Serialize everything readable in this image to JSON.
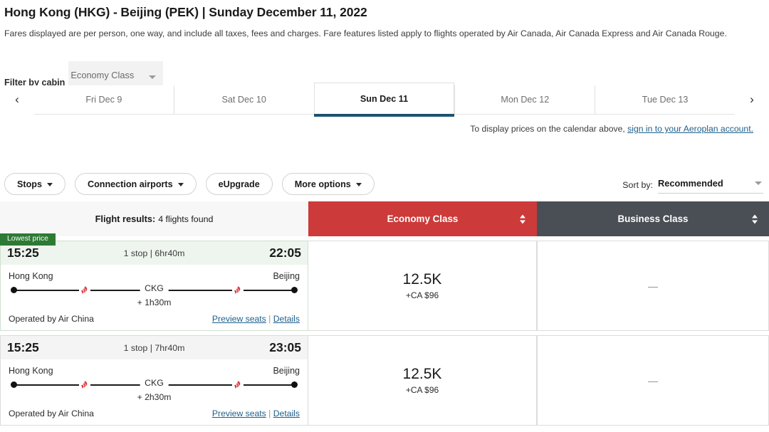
{
  "header": {
    "title": "Hong Kong (HKG) - Beijing (PEK)  |  Sunday December 11, 2022",
    "subtitle": "Fares displayed are per person, one way, and include all taxes, fees and charges. Fare features listed apply to flights operated by Air Canada, Air Canada Express and Air Canada Rouge."
  },
  "cabin_filter": {
    "label": "Filter by cabin",
    "value": "Economy Class"
  },
  "datebar": {
    "prev_arrow": "‹",
    "next_arrow": "›",
    "tabs": [
      {
        "day": "Fri",
        "date": "Dec 9",
        "label": "Fri Dec 9",
        "active": false
      },
      {
        "day": "Sat",
        "date": "Dec 10",
        "label": "Sat Dec 10",
        "active": false
      },
      {
        "day": "Sun",
        "date": "Dec 11",
        "label": "Sun Dec 11",
        "active": true
      },
      {
        "day": "Mon",
        "date": "Dec 12",
        "label": "Mon Dec 12",
        "active": false
      },
      {
        "day": "Tue",
        "date": "Dec 13",
        "label": "Tue Dec 13",
        "active": false
      }
    ]
  },
  "aeroplan_note": {
    "text": "To display prices on the calendar above, ",
    "link": "sign in to your Aeroplan account."
  },
  "filters": [
    {
      "label": "Stops",
      "has_caret": true
    },
    {
      "label": "Connection airports",
      "has_caret": true
    },
    {
      "label": "eUpgrade",
      "has_caret": false
    },
    {
      "label": "More options",
      "has_caret": true
    }
  ],
  "sort": {
    "label": "Sort by:",
    "value": "Recommended"
  },
  "results_header": {
    "info_label": "Flight results:",
    "info_count": "4 flights found",
    "economy_label": "Economy Class",
    "business_label": "Business Class",
    "economy_color": "#cc3a3a",
    "business_color": "#4a4f55"
  },
  "flights": [
    {
      "badge": "Lowest price",
      "lowest": true,
      "depart_time": "15:25",
      "arrive_time": "22:05",
      "summary": "1 stop | 6hr40m",
      "origin": "Hong Kong",
      "destination": "Beijing",
      "stop_code": "CKG",
      "layover": "+ 1h30m",
      "operator": "Operated by Air China",
      "preview_link": "Preview seats",
      "separator": "|",
      "details_link": "Details",
      "economy": {
        "points": "12.5K",
        "cash": "+CA $96"
      },
      "business": {
        "unavailable": "—"
      }
    },
    {
      "badge": "",
      "lowest": false,
      "depart_time": "15:25",
      "arrive_time": "23:05",
      "summary": "1 stop | 7hr40m",
      "origin": "Hong Kong",
      "destination": "Beijing",
      "stop_code": "CKG",
      "layover": "+ 2h30m",
      "operator": "Operated by Air China",
      "preview_link": "Preview seats",
      "separator": "|",
      "details_link": "Details",
      "economy": {
        "points": "12.5K",
        "cash": "+CA $96"
      },
      "business": {
        "unavailable": "—"
      }
    }
  ]
}
